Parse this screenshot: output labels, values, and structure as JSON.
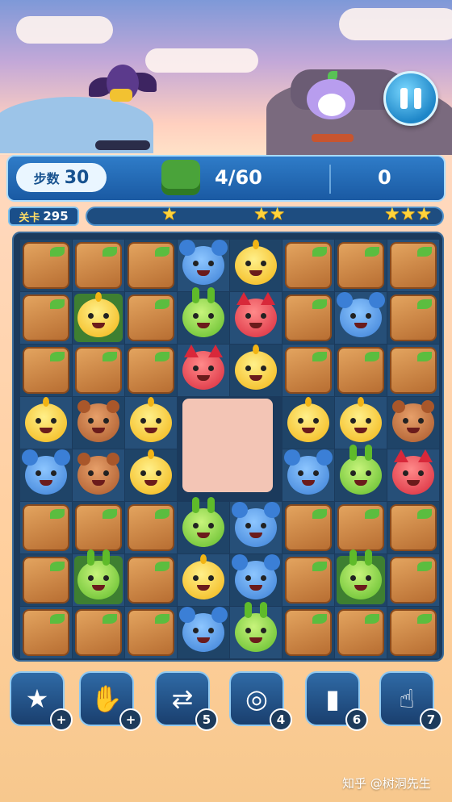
{
  "hud": {
    "steps_label": "步数",
    "steps_value": "30",
    "goal_count": "4/60",
    "score": "0",
    "level_label": "关卡",
    "level_value": "295",
    "stars": [
      "★",
      "★★",
      "★★★"
    ],
    "progress_fraction": 0.0
  },
  "board": {
    "legend": {
      "B": "wooden-crate",
      "G": "chick",
      "M": "mouse",
      "F": "fox",
      "R": "bunny",
      "E": "bear",
      "X": "empty"
    },
    "rows": [
      [
        "B",
        "B",
        "B",
        "M",
        "G",
        "B",
        "B",
        "B"
      ],
      [
        "B",
        "G",
        "B",
        "R",
        "F",
        "B",
        "M",
        "B"
      ],
      [
        "B",
        "B",
        "B",
        "F",
        "G",
        "B",
        "B",
        "B"
      ],
      [
        "G",
        "E",
        "G",
        "X",
        "X",
        "G",
        "G",
        "E"
      ],
      [
        "M",
        "E",
        "G",
        "X",
        "X",
        "M",
        "R",
        "F"
      ],
      [
        "B",
        "B",
        "B",
        "R",
        "M",
        "B",
        "B",
        "B"
      ],
      [
        "B",
        "R",
        "B",
        "G",
        "M",
        "B",
        "R",
        "B"
      ],
      [
        "B",
        "B",
        "B",
        "M",
        "R",
        "B",
        "B",
        "B"
      ]
    ],
    "grass_cells": [
      [
        1,
        1
      ],
      [
        6,
        1
      ],
      [
        6,
        6
      ]
    ]
  },
  "boosters": [
    {
      "icon": "magic-wand-icon",
      "glyph": "★",
      "count": "+"
    },
    {
      "icon": "glove-icon",
      "glyph": "✋",
      "count": "+"
    },
    {
      "icon": "swap-arrows-icon",
      "glyph": "⇄",
      "count": "5"
    },
    {
      "icon": "goggles-icon",
      "glyph": "◎",
      "count": "4"
    },
    {
      "icon": "paint-roller-icon",
      "glyph": "▮",
      "count": "6"
    },
    {
      "icon": "hand-pointer-icon",
      "glyph": "☝",
      "count": "7"
    }
  ],
  "watermark": "知乎 @树洞先生",
  "colors": {
    "accent": "#2f7cc8",
    "board_bg": "#1b3a5c",
    "star": "#ffd33b"
  }
}
